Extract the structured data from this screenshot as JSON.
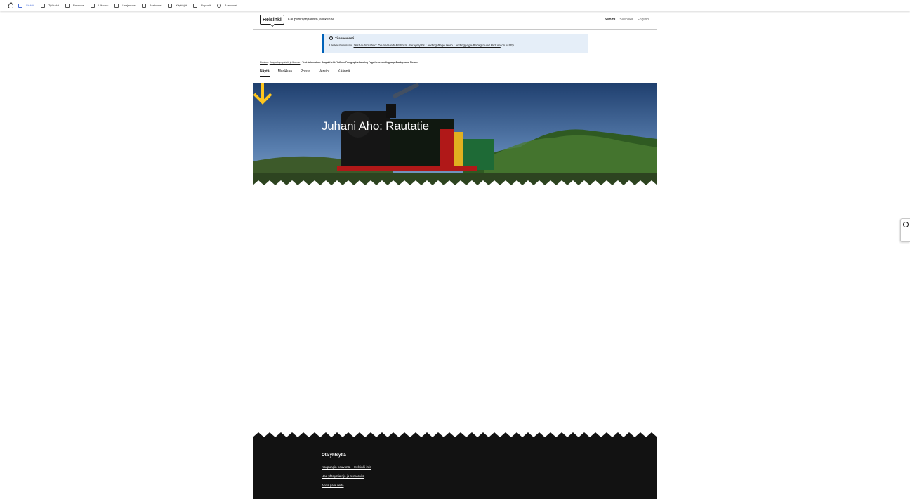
{
  "toolbar": {
    "items": [
      {
        "label": "Sisältö",
        "icon": "content-icon",
        "active": true
      },
      {
        "label": "Työkalut",
        "icon": "tools-icon"
      },
      {
        "label": "Rakenne",
        "icon": "structure-icon"
      },
      {
        "label": "Ulkoasu",
        "icon": "appearance-icon"
      },
      {
        "label": "Laajennus",
        "icon": "extend-icon"
      },
      {
        "label": "Asetukset",
        "icon": "config-icon"
      },
      {
        "label": "Käyttäjät",
        "icon": "people-icon"
      },
      {
        "label": "Raportit",
        "icon": "reports-icon"
      },
      {
        "label": "Asetukset",
        "icon": "settings-icon"
      }
    ]
  },
  "header": {
    "logo": "Helsinki",
    "site_name": "Kaupunkiympäristö ja liikenne",
    "languages": [
      "Suomi",
      "Svenska",
      "English"
    ],
    "current_language": "Suomi"
  },
  "notice": {
    "title": "Tilanneviesti",
    "text_before": "Laskeutumissivu ",
    "link": "Test Automation: Drupal-Helfi-Platform.Paragraphs.Landing Page.Hero.Landingpage-Background Picture",
    "text_after": " on lisätty."
  },
  "breadcrumb": {
    "items": [
      "Etusivu",
      "Kaupunkiympäristö ja liikenne"
    ],
    "current": "Test Automation: Drupal-Helfi-Platform.Paragraphs.Landing Page.Hero.Landingpage-Background Picture",
    "separator": "›"
  },
  "tabs": [
    {
      "label": "Näytä",
      "active": true
    },
    {
      "label": "Muokkaa"
    },
    {
      "label": "Poista"
    },
    {
      "label": "Versiot"
    },
    {
      "label": "Käännä"
    }
  ],
  "hero": {
    "title": "Juhani Aho: Rautatie",
    "arrow_color": "#ffc61e"
  },
  "footer": {
    "title": "Ota yhteyttä",
    "links": [
      "Kaupungin neuvonta – Helsinki-info",
      "Hae yhteystietoja ja numeroita",
      "Anna palautetta"
    ],
    "background": "#121212"
  },
  "colors": {
    "accent": "#0062b9",
    "notice_bg": "#e5eef8",
    "admin_active": "#4a6fd6"
  }
}
